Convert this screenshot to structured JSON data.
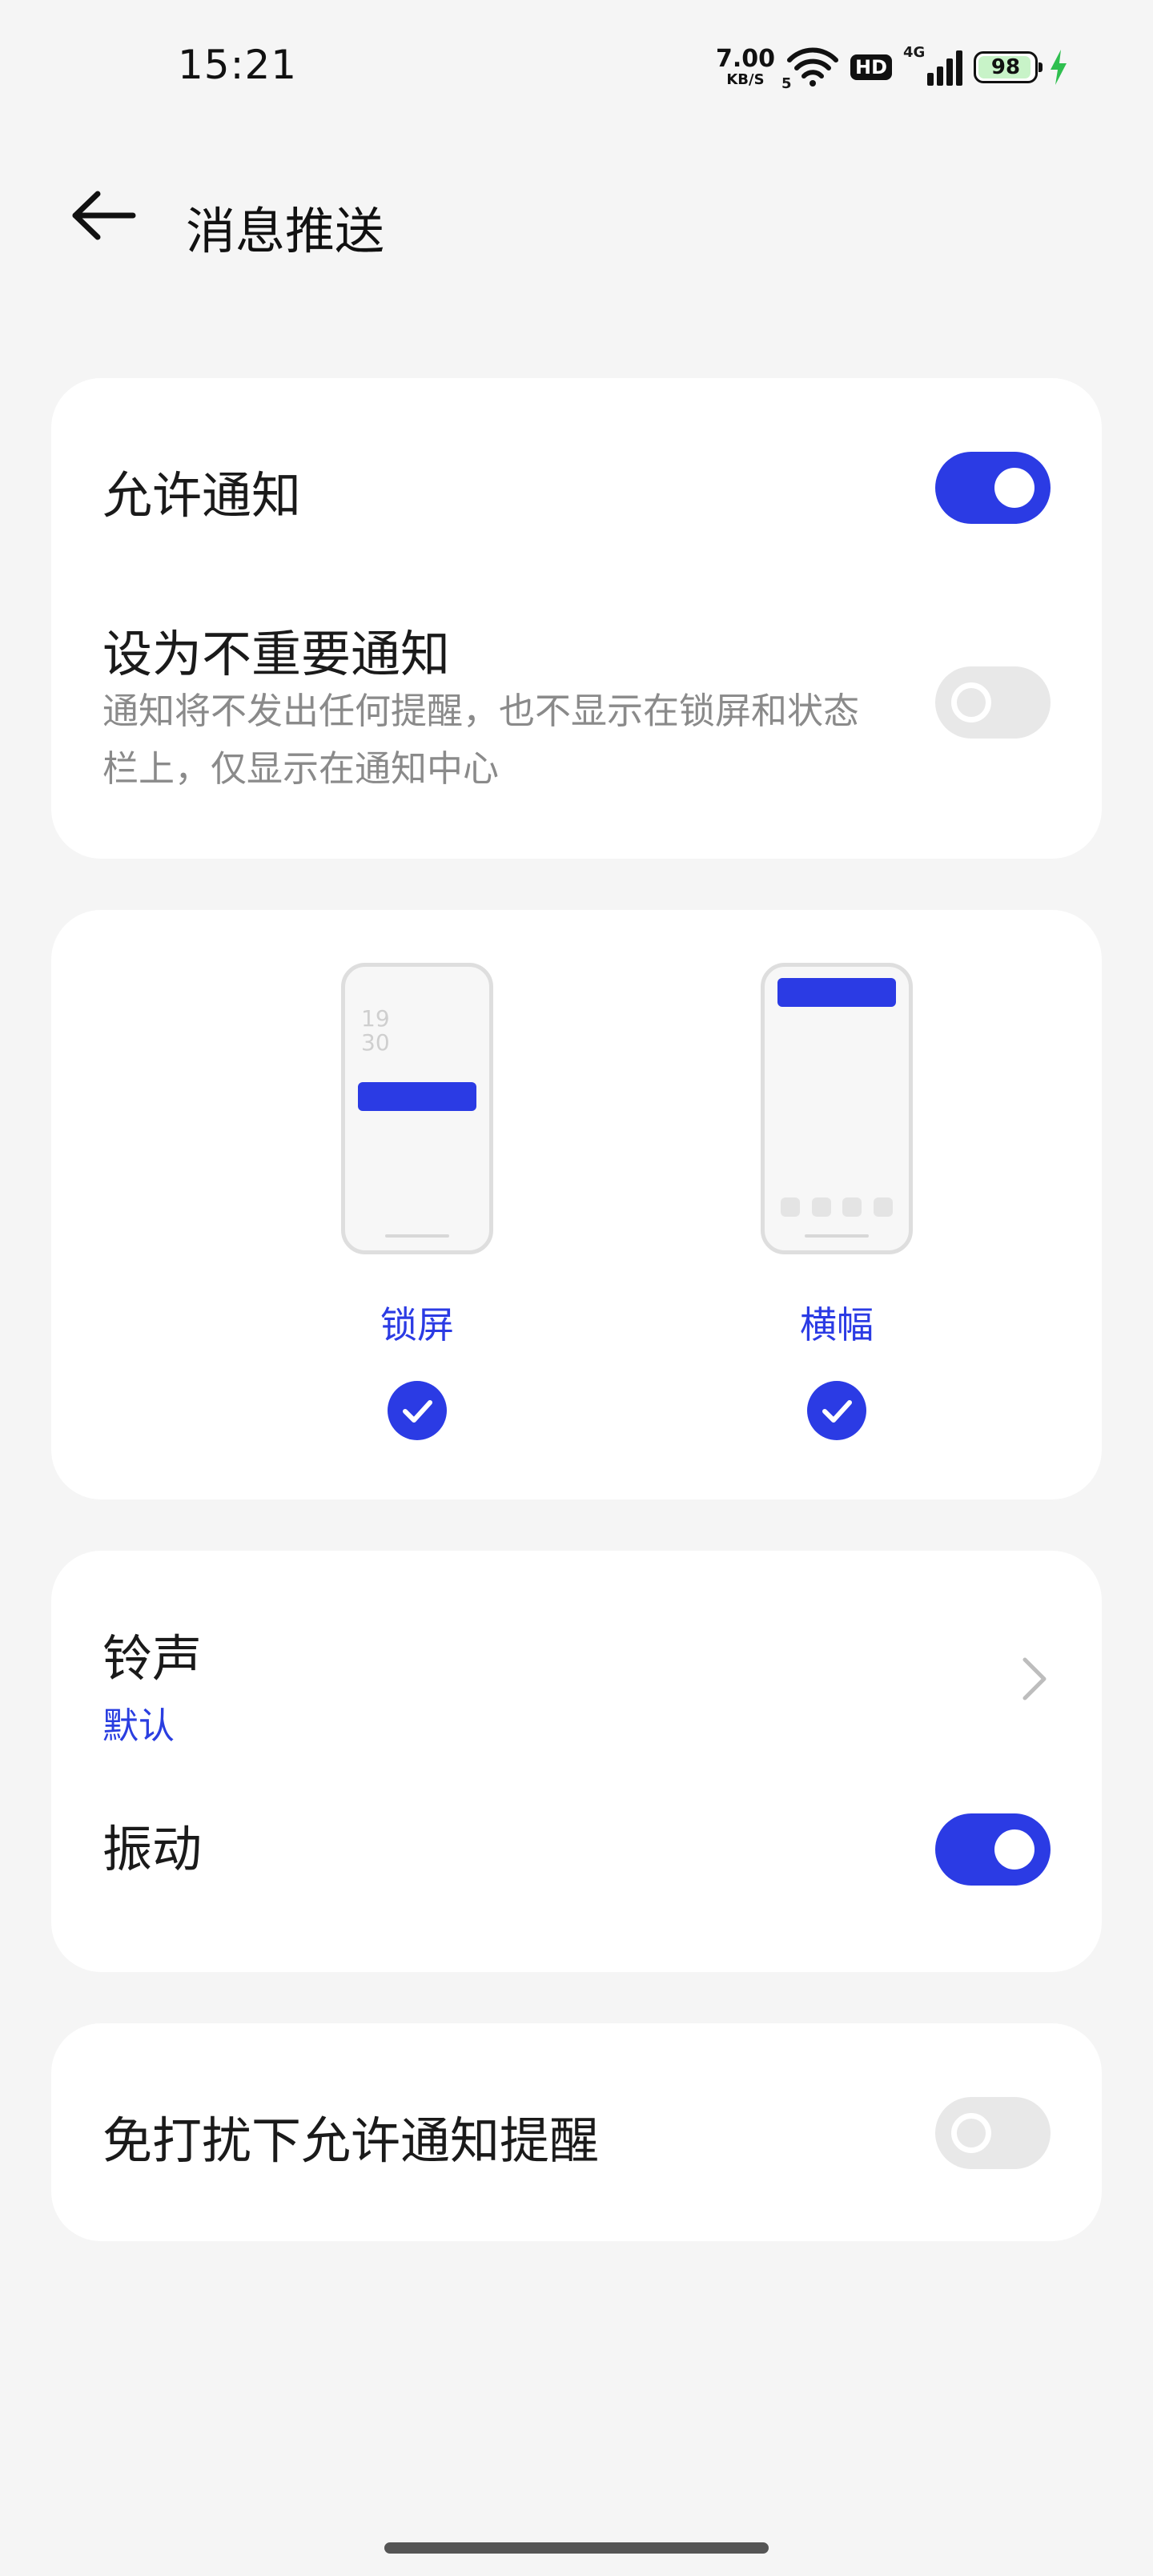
{
  "status_bar": {
    "time": "15:21",
    "net_speed": "7.00",
    "net_speed_unit": "KB/S",
    "wifi_badge": "5",
    "hd": "HD",
    "signal_type": "4G",
    "battery_level": "98",
    "charging": true
  },
  "header": {
    "title": "消息推送",
    "back_icon": "back-arrow-icon"
  },
  "notifications_card": {
    "allow_label": "允许通知",
    "allow_enabled": true,
    "unimportant_label": "设为不重要通知",
    "unimportant_description": "通知将不发出任何提醒，也不显示在锁屏和状态栏上，仅显示在通知中心",
    "unimportant_enabled": false
  },
  "styles_card": {
    "lockscreen": {
      "label": "锁屏",
      "clock_hour": "19",
      "clock_minute": "30",
      "checked": true
    },
    "banner": {
      "label": "横幅",
      "checked": true
    }
  },
  "sound_card": {
    "ringtone_label": "铃声",
    "ringtone_value": "默认",
    "vibrate_label": "振动",
    "vibrate_enabled": true
  },
  "dnd_card": {
    "label": "免打扰下允许通知提醒",
    "enabled": false
  },
  "colors": {
    "accent": "#2b3be4",
    "background": "#f5f5f5",
    "card": "#ffffff",
    "secondary_text": "#8a8a8a"
  }
}
